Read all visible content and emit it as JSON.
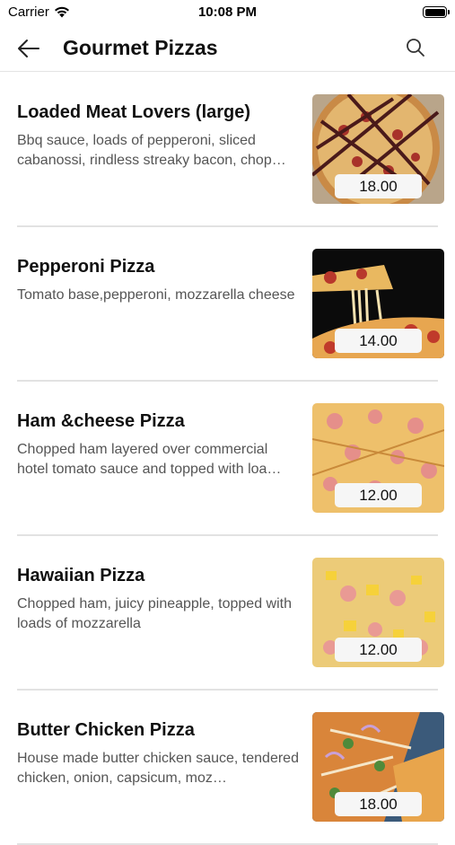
{
  "status_bar": {
    "carrier": "Carrier",
    "time": "10:08 PM",
    "icons": [
      "wifi-icon",
      "battery-icon"
    ]
  },
  "nav": {
    "title": "Gourmet Pizzas",
    "back_icon": "arrow-left-icon",
    "search_icon": "search-icon"
  },
  "menu": {
    "items": [
      {
        "name": "Loaded Meat Lovers (large)",
        "description": "Bbq sauce, loads of pepperoni, sliced cabanossi, rindless streaky bacon, chop…",
        "price": "18.00",
        "image": "meat-lovers-pizza-photo"
      },
      {
        "name": "Pepperoni Pizza",
        "description": "Tomato base,pepperoni, mozzarella cheese",
        "price": "14.00",
        "image": "pepperoni-pizza-photo"
      },
      {
        "name": "Ham &cheese Pizza",
        "description": "Chopped ham layered over commercial hotel tomato sauce and topped with loa…",
        "price": "12.00",
        "image": "ham-cheese-pizza-photo"
      },
      {
        "name": "Hawaiian Pizza",
        "description": "Chopped ham, juicy pineapple, topped with loads of mozzarella",
        "price": "12.00",
        "image": "hawaiian-pizza-photo"
      },
      {
        "name": "Butter Chicken Pizza",
        "description": "House made butter chicken sauce, tendered chicken, onion, capsicum, moz…",
        "price": "18.00",
        "image": "butter-chicken-pizza-photo"
      }
    ]
  }
}
